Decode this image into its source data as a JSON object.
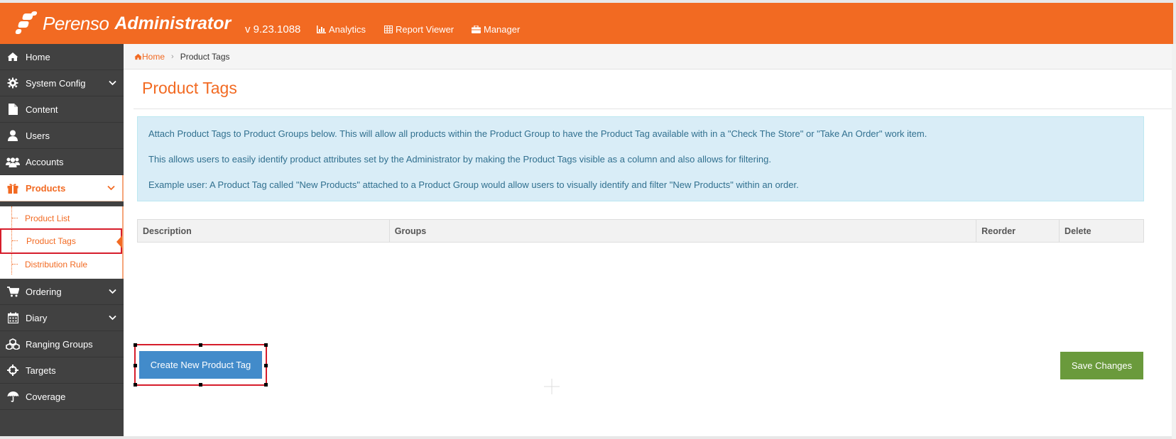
{
  "header": {
    "brand": "Perenso",
    "product": "Administrator",
    "version": "v 9.23.1088",
    "nav": [
      {
        "label": "Analytics",
        "icon": "bar-chart-icon"
      },
      {
        "label": "Report Viewer",
        "icon": "table-icon"
      },
      {
        "label": "Manager",
        "icon": "briefcase-icon"
      }
    ]
  },
  "sidebar": {
    "items": [
      {
        "label": "Home",
        "icon": "home-icon"
      },
      {
        "label": "System Config",
        "icon": "gear-icon",
        "expandable": true
      },
      {
        "label": "Content",
        "icon": "document-icon"
      },
      {
        "label": "Users",
        "icon": "user-icon"
      },
      {
        "label": "Accounts",
        "icon": "users-icon"
      },
      {
        "label": "Products",
        "icon": "gift-icon",
        "expandable": true,
        "active": true
      },
      {
        "label": "Ordering",
        "icon": "cart-icon",
        "expandable": true
      },
      {
        "label": "Diary",
        "icon": "calendar-icon",
        "expandable": true
      },
      {
        "label": "Ranging Groups",
        "icon": "cubes-icon"
      },
      {
        "label": "Targets",
        "icon": "crosshairs-icon"
      },
      {
        "label": "Coverage",
        "icon": "umbrella-icon"
      }
    ],
    "products_sub": [
      {
        "label": "Product List"
      },
      {
        "label": "Product Tags",
        "active": true
      },
      {
        "label": "Distribution Rule"
      }
    ]
  },
  "breadcrumb": {
    "home": "Home",
    "current": "Product Tags"
  },
  "page": {
    "title": "Product Tags",
    "info": [
      "Attach Product Tags to Product Groups below. This will allow all products within the Product Group to have the Product Tag available with in a \"Check The Store\" or \"Take An Order\" work item.",
      "This allows users to easily identify product attributes set by the Administrator by making the Product Tags visible as a column and also allows for filtering.",
      "Example user: A Product Tag called \"New Products\" attached to a Product Group would allow users to visually identify and filter \"New Products\" within an order."
    ],
    "table": {
      "columns": [
        "Description",
        "Groups",
        "Reorder",
        "Delete"
      ],
      "rows": []
    },
    "create_button": "Create New Product Tag",
    "save_button": "Save Changes"
  },
  "colors": {
    "brand_orange": "#f26a22",
    "sidebar_bg": "#414141",
    "info_bg": "#d9edf7",
    "primary_blue": "#428bca",
    "save_green": "#6a9a3c",
    "highlight_red": "#d61d2b"
  }
}
